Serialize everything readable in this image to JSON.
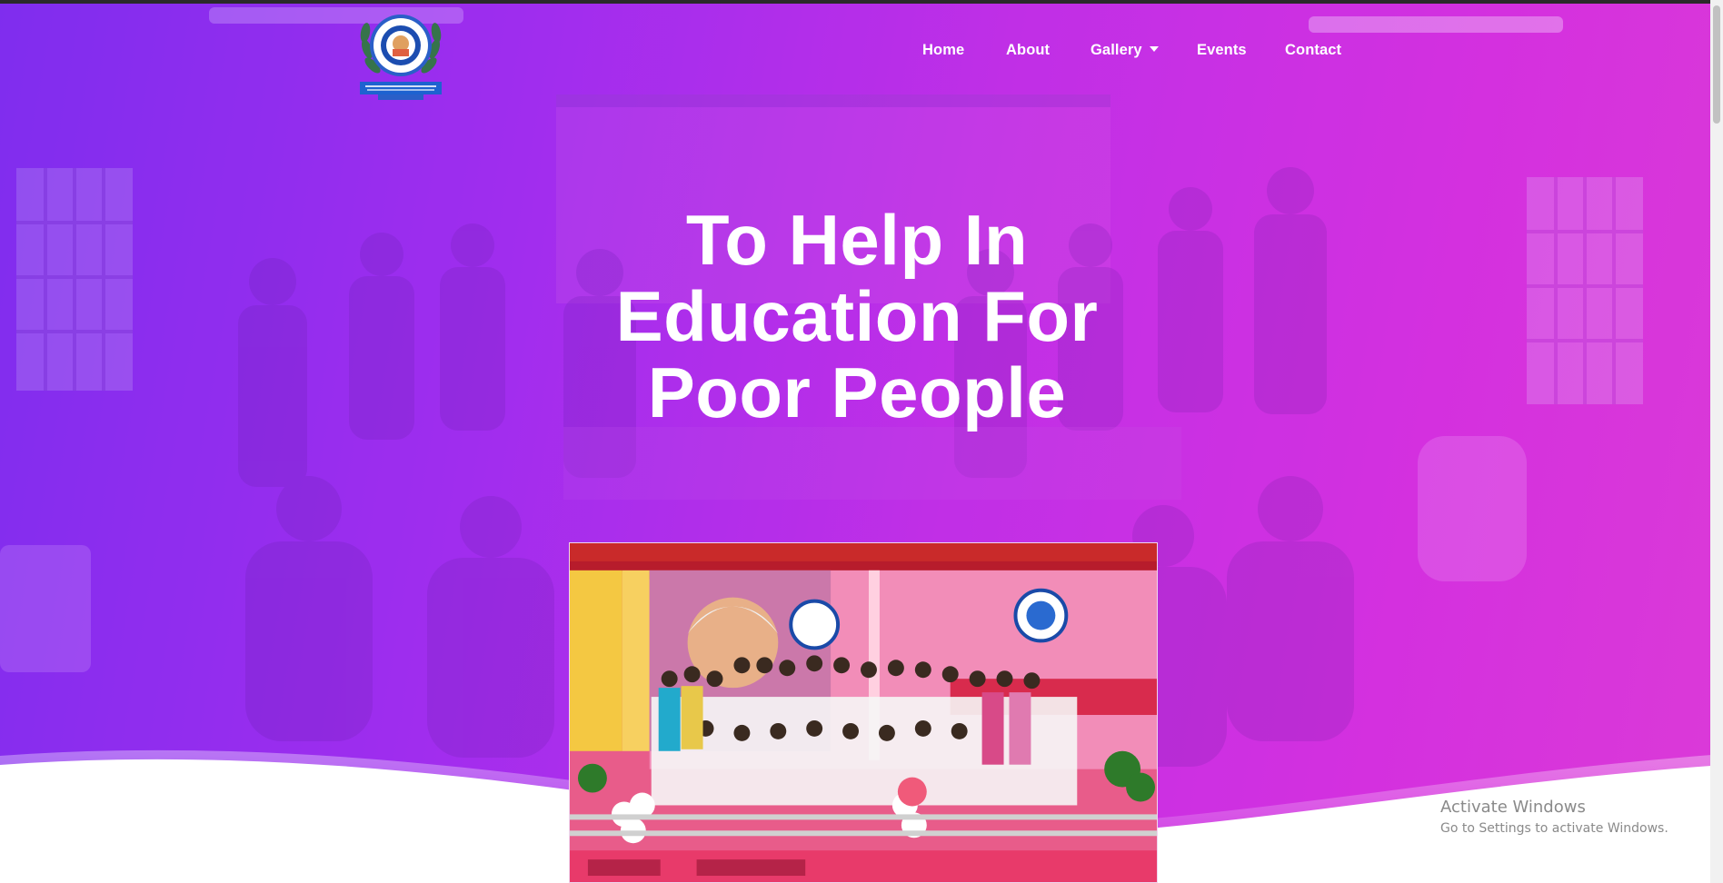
{
  "nav": {
    "home": "Home",
    "about": "About",
    "gallery": "Gallery",
    "events": "Events",
    "contact": "Contact"
  },
  "hero": {
    "headline_line1": "To Help In",
    "headline_line2": "Education For",
    "headline_line3": "Poor People"
  },
  "watermark": {
    "title": "Activate Windows",
    "subtitle": "Go to Settings to activate Windows."
  },
  "colors": {
    "gradient_start": "#7d2cf0",
    "gradient_end": "#e03ad8",
    "text": "#ffffff"
  }
}
